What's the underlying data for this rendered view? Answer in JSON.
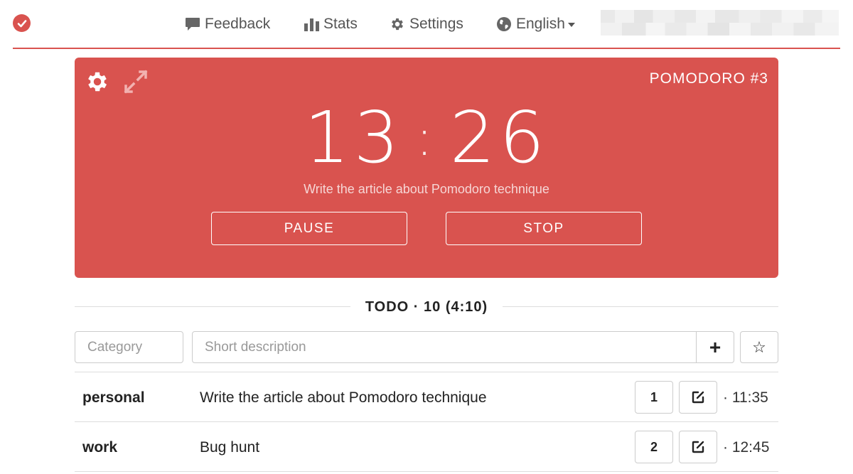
{
  "nav": {
    "feedback": "Feedback",
    "stats": "Stats",
    "settings": "Settings",
    "language": "English"
  },
  "timer": {
    "pomodoro_label": "POMODORO #3",
    "minutes": "13",
    "separator": ":",
    "seconds": "26",
    "current_task": "Write the article about Pomodoro technique",
    "pause_label": "PAUSE",
    "stop_label": "STOP"
  },
  "todo": {
    "title": "TODO · 10 (4:10)",
    "category_placeholder": "Category",
    "description_placeholder": "Short description",
    "add_icon": "+",
    "star_icon": "☆",
    "tasks": [
      {
        "category": "personal",
        "description": "Write the article about Pomodoro technique",
        "pomodoros": "1",
        "time": "· 11:35"
      },
      {
        "category": "work",
        "description": "Bug hunt",
        "pomodoros": "2",
        "time": "· 12:45"
      }
    ]
  },
  "colors": {
    "accent": "#d9534f",
    "border": "#cccccc",
    "text": "#222222"
  },
  "icons": [
    "check-circle-icon",
    "comment-icon",
    "bar-chart-icon",
    "gear-icon",
    "globe-icon",
    "expand-icon",
    "plus-icon",
    "star-icon",
    "edit-icon"
  ]
}
